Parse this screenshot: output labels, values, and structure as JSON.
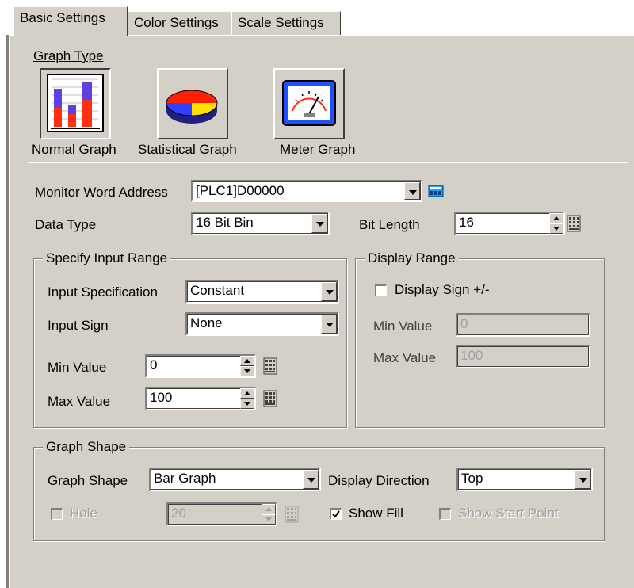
{
  "tabs": [
    {
      "label": "Basic Settings",
      "active": true
    },
    {
      "label": "Color Settings",
      "active": false
    },
    {
      "label": "Scale Settings",
      "active": false
    }
  ],
  "graph_type": {
    "label": "Graph Type",
    "options": [
      {
        "label": "Normal Graph",
        "icon": "normal-graph-icon",
        "selected": true
      },
      {
        "label": "Statistical Graph",
        "icon": "pie-chart-icon",
        "selected": false
      },
      {
        "label": "Meter Graph",
        "icon": "meter-gauge-icon",
        "selected": false
      }
    ]
  },
  "monitor": {
    "label": "Monitor Word Address",
    "value": "[PLC1]D00000"
  },
  "data_type": {
    "label": "Data Type",
    "value": "16 Bit Bin"
  },
  "bit_length": {
    "label": "Bit Length",
    "value": "16"
  },
  "input_range": {
    "title": "Specify Input Range",
    "spec_label": "Input Specification",
    "spec_value": "Constant",
    "sign_label": "Input Sign",
    "sign_value": "None",
    "min_label": "Min Value",
    "min_value": "0",
    "max_label": "Max Value",
    "max_value": "100"
  },
  "display_range": {
    "title": "Display Range",
    "sign_label": "Display Sign +/-",
    "sign_checked": false,
    "min_label": "Min Value",
    "min_value": "0",
    "max_label": "Max Value",
    "max_value": "100"
  },
  "graph_shape": {
    "title": "Graph Shape",
    "shape_label": "Graph Shape",
    "shape_value": "Bar Graph",
    "direction_label": "Display Direction",
    "direction_value": "Top",
    "hole_label": "Hole",
    "hole_value": "20",
    "show_fill_label": "Show Fill",
    "show_fill_checked": true,
    "show_start_label": "Show Start Point"
  },
  "colors": {
    "face": "#d4d0c8",
    "shadow": "#808080",
    "highlight": "#ffffff",
    "disabled": "#a0a0a0"
  }
}
